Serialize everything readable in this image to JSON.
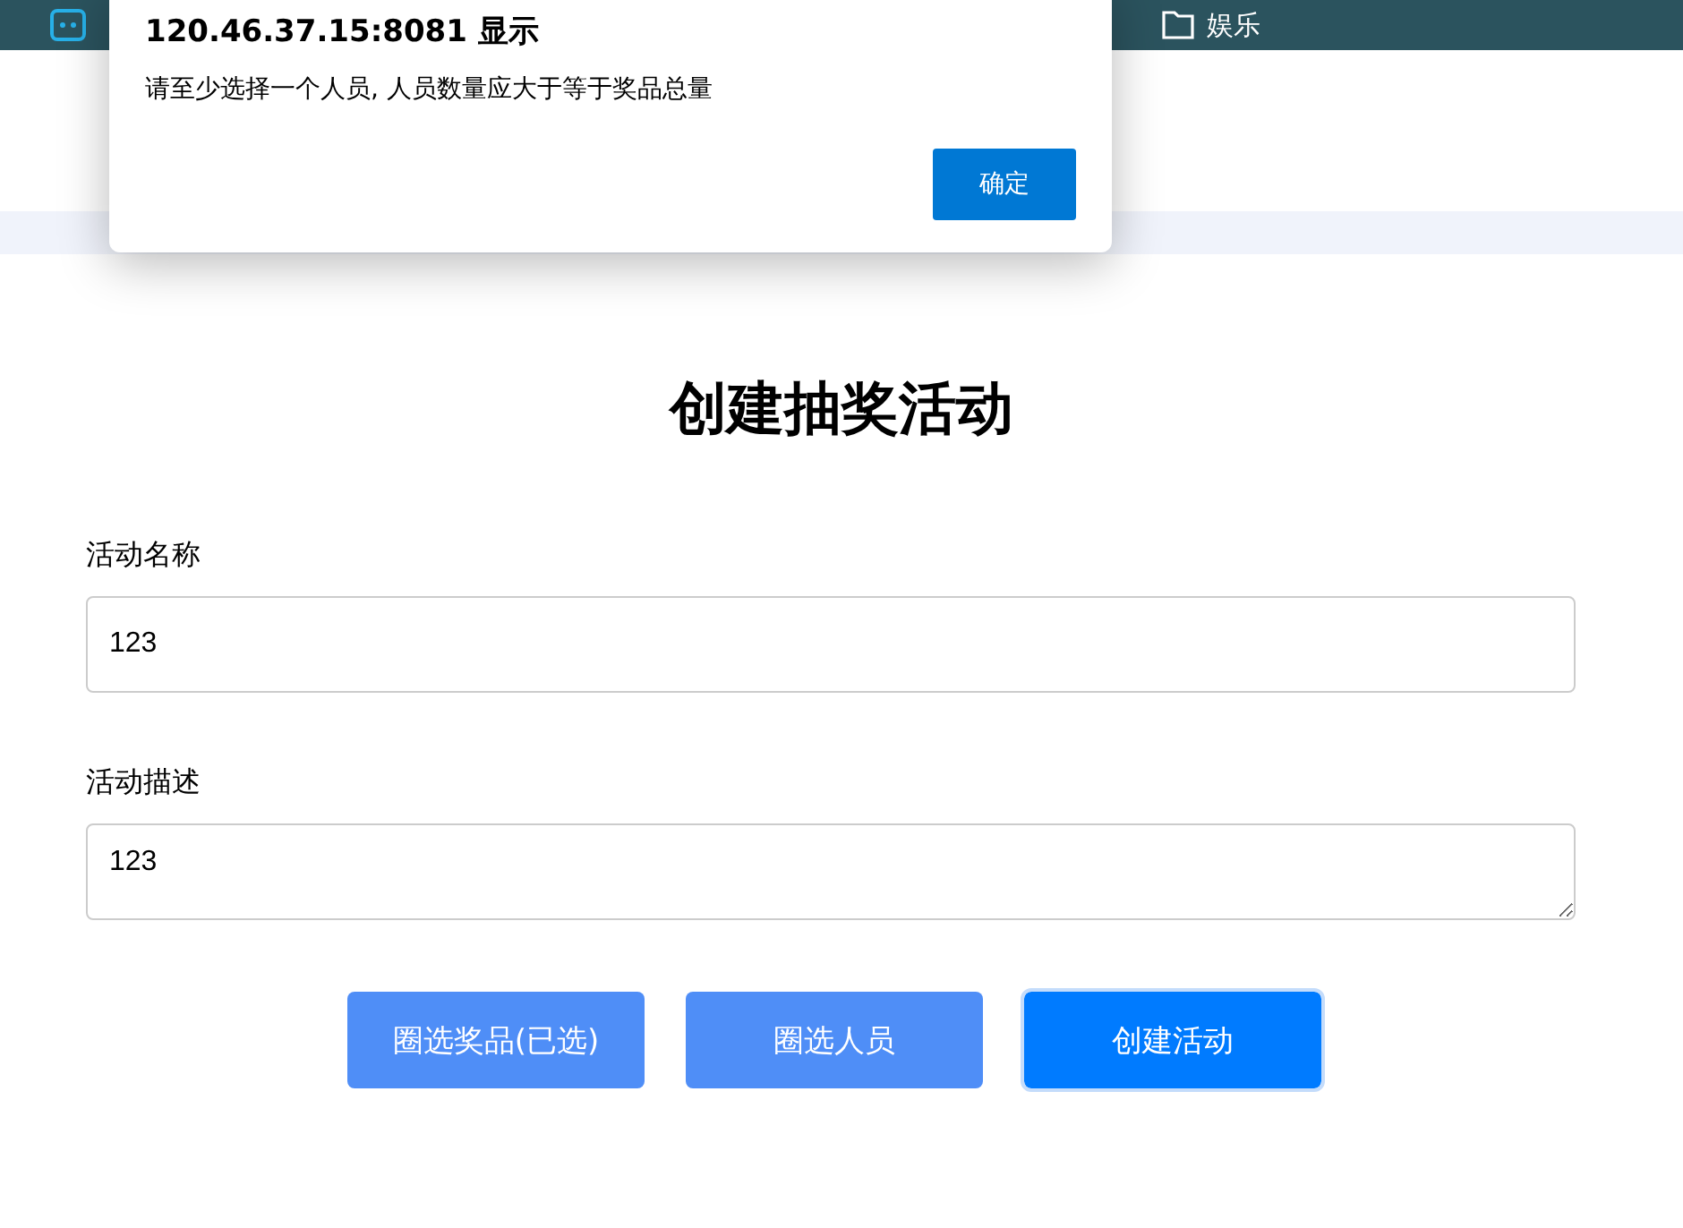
{
  "bookmarks_bar": {
    "items": [
      {
        "kind": "app"
      },
      {
        "kind": "folder",
        "label": "娱乐"
      }
    ]
  },
  "page": {
    "title": "创建抽奖活动",
    "fields": [
      {
        "kind": "input",
        "label": "活动名称",
        "value": "123"
      },
      {
        "kind": "textarea",
        "label": "活动描述",
        "value": "123"
      }
    ],
    "buttons": [
      {
        "label": "圈选奖品(已选)",
        "kind": "secondary",
        "focused": false
      },
      {
        "label": "圈选人员",
        "kind": "secondary",
        "focused": false
      },
      {
        "label": "创建活动",
        "kind": "primary",
        "focused": true
      }
    ]
  },
  "dialog": {
    "title": "120.46.37.15:8081 显示",
    "message": "请至少选择一个人员, 人员数量应大于等于奖品总量",
    "button": "确定"
  }
}
